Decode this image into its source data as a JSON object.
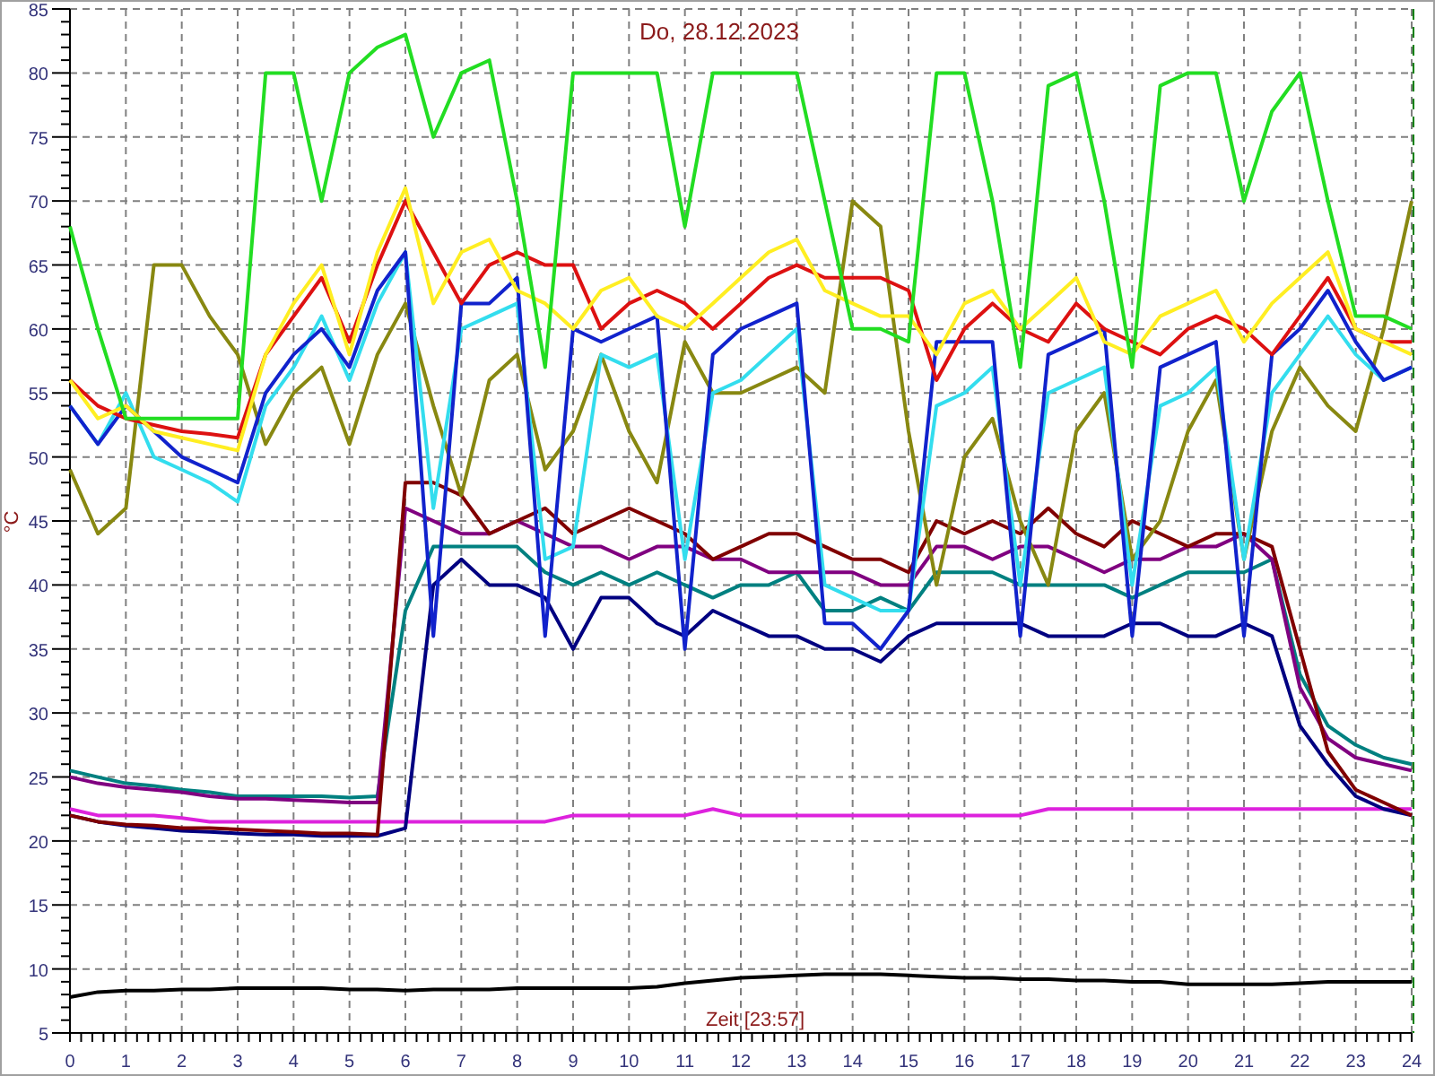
{
  "chart_data": {
    "type": "line",
    "title": "Do, 28.12.2023",
    "xlabel": "Zeit [23:57]",
    "ylabel": "°C",
    "x": [
      0,
      0.5,
      1,
      1.5,
      2,
      2.5,
      3,
      3.5,
      4,
      4.5,
      5,
      5.5,
      6,
      6.5,
      7,
      7.5,
      8,
      8.5,
      9,
      9.5,
      10,
      10.5,
      11,
      11.5,
      12,
      12.5,
      13,
      13.5,
      14,
      14.5,
      15,
      15.5,
      16,
      16.5,
      17,
      17.5,
      18,
      18.5,
      19,
      19.5,
      20,
      20.5,
      21,
      21.5,
      22,
      22.5,
      23,
      23.5,
      24
    ],
    "xlim": [
      0,
      24
    ],
    "ylim": [
      5,
      85
    ],
    "xticks": [
      0,
      1,
      2,
      3,
      4,
      5,
      6,
      7,
      8,
      9,
      10,
      11,
      12,
      13,
      14,
      15,
      16,
      17,
      18,
      19,
      20,
      21,
      22,
      23,
      24
    ],
    "yticks": [
      5,
      10,
      15,
      20,
      25,
      30,
      35,
      40,
      45,
      50,
      55,
      60,
      65,
      70,
      75,
      80,
      85
    ],
    "series": [
      {
        "color": "#000000",
        "values": [
          7.8,
          8.2,
          8.3,
          8.3,
          8.4,
          8.4,
          8.5,
          8.5,
          8.5,
          8.5,
          8.4,
          8.4,
          8.3,
          8.4,
          8.4,
          8.4,
          8.5,
          8.5,
          8.5,
          8.5,
          8.5,
          8.6,
          8.9,
          9.1,
          9.3,
          9.4,
          9.5,
          9.6,
          9.6,
          9.6,
          9.5,
          9.4,
          9.3,
          9.3,
          9.2,
          9.2,
          9.1,
          9.1,
          9.0,
          9.0,
          8.8,
          8.8,
          8.8,
          8.8,
          8.9,
          9.0,
          9.0,
          9.0,
          9.0
        ]
      },
      {
        "color": "#dd22dd",
        "values": [
          22.5,
          22,
          22,
          22,
          21.8,
          21.5,
          21.5,
          21.5,
          21.5,
          21.5,
          21.5,
          21.5,
          21.5,
          21.5,
          21.5,
          21.5,
          21.5,
          21.5,
          22,
          22,
          22,
          22,
          22,
          22.5,
          22,
          22,
          22,
          22,
          22,
          22,
          22,
          22,
          22,
          22,
          22,
          22.5,
          22.5,
          22.5,
          22.5,
          22.5,
          22.5,
          22.5,
          22.5,
          22.5,
          22.5,
          22.5,
          22.5,
          22.5,
          22.5
        ]
      },
      {
        "color": "#000080",
        "values": [
          22,
          21.5,
          21.2,
          21,
          20.8,
          20.7,
          20.6,
          20.5,
          20.5,
          20.4,
          20.4,
          20.4,
          21,
          40,
          42,
          40,
          40,
          39,
          35,
          39,
          39,
          37,
          36,
          38,
          37,
          36,
          36,
          35,
          35,
          34,
          36,
          37,
          37,
          37,
          37,
          36,
          36,
          36,
          37,
          37,
          36,
          36,
          37,
          36,
          29,
          26,
          23.5,
          22.5,
          22
        ]
      },
      {
        "color": "#008080",
        "values": [
          25.5,
          25,
          24.5,
          24.3,
          24,
          23.8,
          23.5,
          23.5,
          23.5,
          23.5,
          23.4,
          23.5,
          38,
          43,
          43,
          43,
          43,
          41,
          40,
          41,
          40,
          41,
          40,
          39,
          40,
          40,
          41,
          38,
          38,
          39,
          38,
          41,
          41,
          41,
          40,
          40,
          40,
          40,
          39,
          40,
          41,
          41,
          41,
          42,
          33,
          29,
          27.5,
          26.5,
          26
        ]
      },
      {
        "color": "#800080",
        "values": [
          25,
          24.5,
          24.2,
          24,
          23.8,
          23.5,
          23.3,
          23.3,
          23.2,
          23.1,
          23,
          23,
          46,
          45,
          44,
          44,
          45,
          44,
          43,
          43,
          42,
          43,
          43,
          42,
          42,
          41,
          41,
          41,
          41,
          40,
          40,
          43,
          43,
          42,
          43,
          43,
          42,
          41,
          42,
          42,
          43,
          43,
          44,
          42,
          32,
          28,
          26.5,
          26,
          25.5
        ]
      },
      {
        "color": "#800000",
        "values": [
          22,
          21.5,
          21.3,
          21.2,
          21,
          21,
          20.9,
          20.8,
          20.7,
          20.6,
          20.6,
          20.5,
          48,
          48,
          47,
          44,
          45,
          46,
          44,
          45,
          46,
          45,
          44,
          42,
          43,
          44,
          44,
          43,
          42,
          42,
          41,
          45,
          44,
          45,
          44,
          46,
          44,
          43,
          45,
          44,
          43,
          44,
          44,
          43,
          35,
          27,
          24,
          23,
          22
        ]
      },
      {
        "color": "#888811",
        "values": [
          49,
          44,
          46,
          65,
          65,
          61,
          58,
          51,
          55,
          57,
          51,
          58,
          62,
          54,
          47,
          56,
          58,
          49,
          52,
          58,
          52,
          48,
          59,
          55,
          55,
          56,
          57,
          55,
          70,
          68,
          52,
          40,
          50,
          53,
          45,
          40,
          52,
          55,
          42,
          45,
          52,
          56,
          42,
          52,
          57,
          54,
          52,
          60,
          70
        ]
      },
      {
        "color": "#33ddee",
        "values": [
          54,
          51,
          55,
          50,
          49,
          48,
          46.5,
          54,
          57,
          61,
          56,
          62,
          66,
          46,
          60,
          61,
          62,
          42,
          43,
          58,
          57,
          58,
          42,
          55,
          56,
          58,
          60,
          40,
          39,
          38,
          38,
          54,
          55,
          57,
          40,
          55,
          56,
          57,
          40,
          54,
          55,
          57,
          42,
          55,
          58,
          61,
          58,
          56,
          57
        ]
      },
      {
        "color": "#1122cc",
        "values": [
          54,
          51,
          54,
          52,
          50,
          49,
          48,
          55,
          58,
          60,
          57,
          63,
          66,
          36,
          62,
          62,
          64,
          36,
          60,
          59,
          60,
          61,
          35,
          58,
          60,
          61,
          62,
          37,
          37,
          35,
          38,
          59,
          59,
          59,
          36,
          58,
          59,
          60,
          36,
          57,
          58,
          59,
          36,
          58,
          60,
          63,
          59,
          56,
          57
        ]
      },
      {
        "color": "#dd1111",
        "values": [
          56,
          54,
          53,
          52.5,
          52,
          51.8,
          51.5,
          58,
          61,
          64,
          59,
          65,
          70,
          66,
          62,
          65,
          66,
          65,
          65,
          60,
          62,
          63,
          62,
          60,
          62,
          64,
          65,
          64,
          64,
          64,
          63,
          56,
          60,
          62,
          60,
          59,
          62,
          60,
          59,
          58,
          60,
          61,
          60,
          58,
          61,
          64,
          60,
          59,
          59
        ]
      },
      {
        "color": "#ffee22",
        "values": [
          56,
          53,
          54,
          52,
          51.5,
          51,
          50.5,
          58,
          62,
          65,
          58,
          66,
          71,
          62,
          66,
          67,
          63,
          62,
          60,
          63,
          64,
          61,
          60,
          62,
          64,
          66,
          67,
          63,
          62,
          61,
          61,
          58,
          62,
          63,
          60,
          62,
          64,
          59,
          58,
          61,
          62,
          63,
          59,
          62,
          64,
          66,
          60,
          59,
          58
        ]
      },
      {
        "color": "#22dd22",
        "values": [
          68,
          60,
          53,
          53,
          53,
          53,
          53,
          80,
          80,
          70,
          80,
          82,
          83,
          75,
          80,
          81,
          70,
          57,
          80,
          80,
          80,
          80,
          68,
          80,
          80,
          80,
          80,
          70,
          60,
          60,
          59,
          80,
          80,
          70,
          57,
          79,
          80,
          70,
          57,
          79,
          80,
          80,
          70,
          77,
          80,
          70,
          61,
          61,
          60
        ]
      }
    ],
    "grid": true
  }
}
